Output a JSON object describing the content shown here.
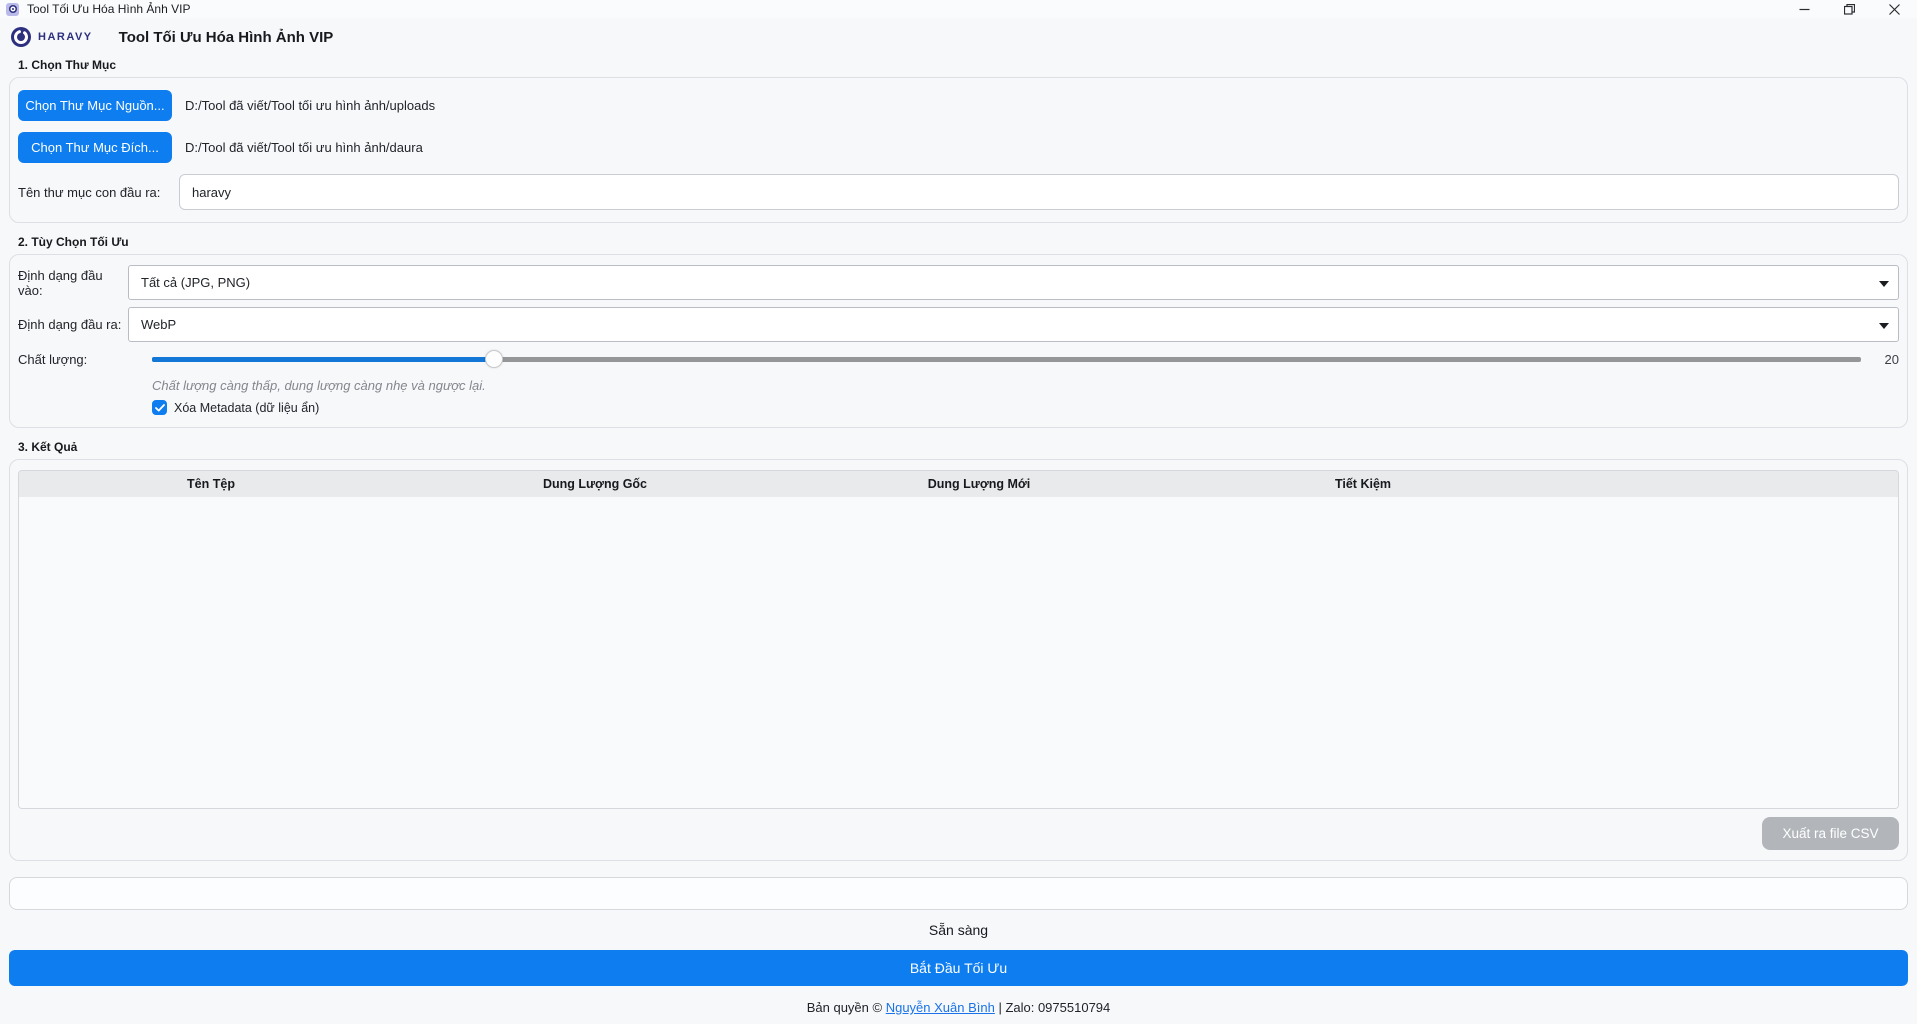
{
  "window": {
    "title": "Tool Tối Ưu Hóa Hình Ảnh VIP"
  },
  "header": {
    "brand": "HARAVY",
    "title": "Tool Tối Ưu Hóa Hình Ảnh VIP"
  },
  "sections": {
    "folders": {
      "title": "1. Chọn Thư Mục",
      "source_button": "Chọn Thư Mục Nguồn...",
      "source_path": "D:/Tool đã viết/Tool tối ưu hình ảnh/uploads",
      "dest_button": "Chọn Thư Mục Đích...",
      "dest_path": "D:/Tool đã viết/Tool tối ưu hình ảnh/daura",
      "subfolder_label": "Tên thư mục con đầu ra:",
      "subfolder_value": "haravy"
    },
    "options": {
      "title": "2. Tùy Chọn Tối Ưu",
      "input_format_label": "Định dạng đầu vào:",
      "input_format_value": "Tất cả (JPG, PNG)",
      "output_format_label": "Định dạng đầu ra:",
      "output_format_value": "WebP",
      "quality_label": "Chất lượng:",
      "quality_value": "20",
      "quality_percent": 20,
      "quality_note": "Chất lượng càng thấp, dung lượng càng nhẹ và ngược lại.",
      "metadata_checkbox_label": "Xóa Metadata (dữ liệu ẩn)",
      "metadata_checked": true
    },
    "results": {
      "title": "3. Kết Quả",
      "columns": [
        "Tên Tệp",
        "Dung Lượng Gốc",
        "Dung Lượng Mới",
        "Tiết Kiệm"
      ],
      "rows": [],
      "export_csv_button": "Xuất ra file CSV"
    }
  },
  "status": {
    "text": "Sẵn sàng",
    "progress_percent": 0
  },
  "actions": {
    "start_button": "Bắt Đầu Tối Ưu"
  },
  "footer": {
    "prefix": "Bản quyền © ",
    "link": "Nguyễn Xuân Bình",
    "suffix": " | Zalo: 0975510794"
  },
  "colors": {
    "accent": "#0d7df0",
    "slider_fill": "#1277d6",
    "link": "#1a73e8",
    "disabled_button": "#b2b6bb",
    "brand_navy": "#2d2f7f"
  }
}
